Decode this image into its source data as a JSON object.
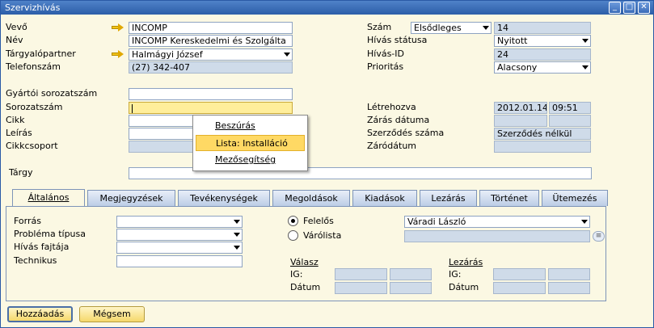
{
  "window": {
    "title": "Szervizhívás"
  },
  "left": {
    "vevo_label": "Vevő",
    "vevo_value": "INCOMP",
    "nev_label": "Név",
    "nev_value": "INCOMP Kereskedelmi és Szolgálta",
    "partner_label": "Tárgyalópartner",
    "partner_value": "Halmágyi József",
    "telefon_label": "Telefonszám",
    "telefon_value": "(27) 342-407",
    "gyartoi_label": "Gyártói sorozatszám",
    "gyartoi_value": "",
    "sorozat_label": "Sorozatszám",
    "sorozat_value": "",
    "cikk_label": "Cikk",
    "leiras_label": "Leírás",
    "cikkcsoport_label": "Cikkcsoport",
    "targy_label": "Tárgy",
    "targy_value": ""
  },
  "right": {
    "szam_label": "Szám",
    "szam_series": "Elsődleges",
    "szam_value": "14",
    "statusz_label": "Hívás státusa",
    "statusz_value": "Nyitott",
    "id_label": "Hívás-ID",
    "id_value": "24",
    "prioritas_label": "Prioritás",
    "prioritas_value": "Alacsony",
    "letrehozva_label": "Létrehozva",
    "letrehozva_date": "2012.01.14",
    "letrehozva_time": "09:51",
    "zaras_datuma_label": "Zárás dátuma",
    "szerzodes_label": "Szerződés száma",
    "szerzodes_value": "Szerződés nélkül",
    "zarodatum_label": "Záródátum"
  },
  "context_menu": {
    "items": [
      "Beszúrás",
      "Lista: Installáció",
      "Mezősegítség"
    ],
    "selected": "Lista: Installáció"
  },
  "tabs": [
    "Általános",
    "Megjegyzések",
    "Tevékenységek",
    "Megoldások",
    "Kiadások",
    "Lezárás",
    "Történet",
    "Ütemezés"
  ],
  "general": {
    "forras_label": "Forrás",
    "problema_label": "Probléma típusa",
    "fajta_label": "Hívás fajtája",
    "technikus_label": "Technikus",
    "felelos_label": "Felelős",
    "felelos_value": "Váradi László",
    "varolista_label": "Várólista",
    "valasz_header": "Válasz",
    "lezaras_header": "Lezárás",
    "ig_label": "IG:",
    "datum_label": "Dátum"
  },
  "buttons": {
    "add": "Hozzáadás",
    "cancel": "Mégsem"
  },
  "colors": {
    "titlebar": "#2c5ea8",
    "background": "#fbf8e3",
    "readonly_field": "#cfdbe9",
    "focus_field": "#ffee9b"
  }
}
